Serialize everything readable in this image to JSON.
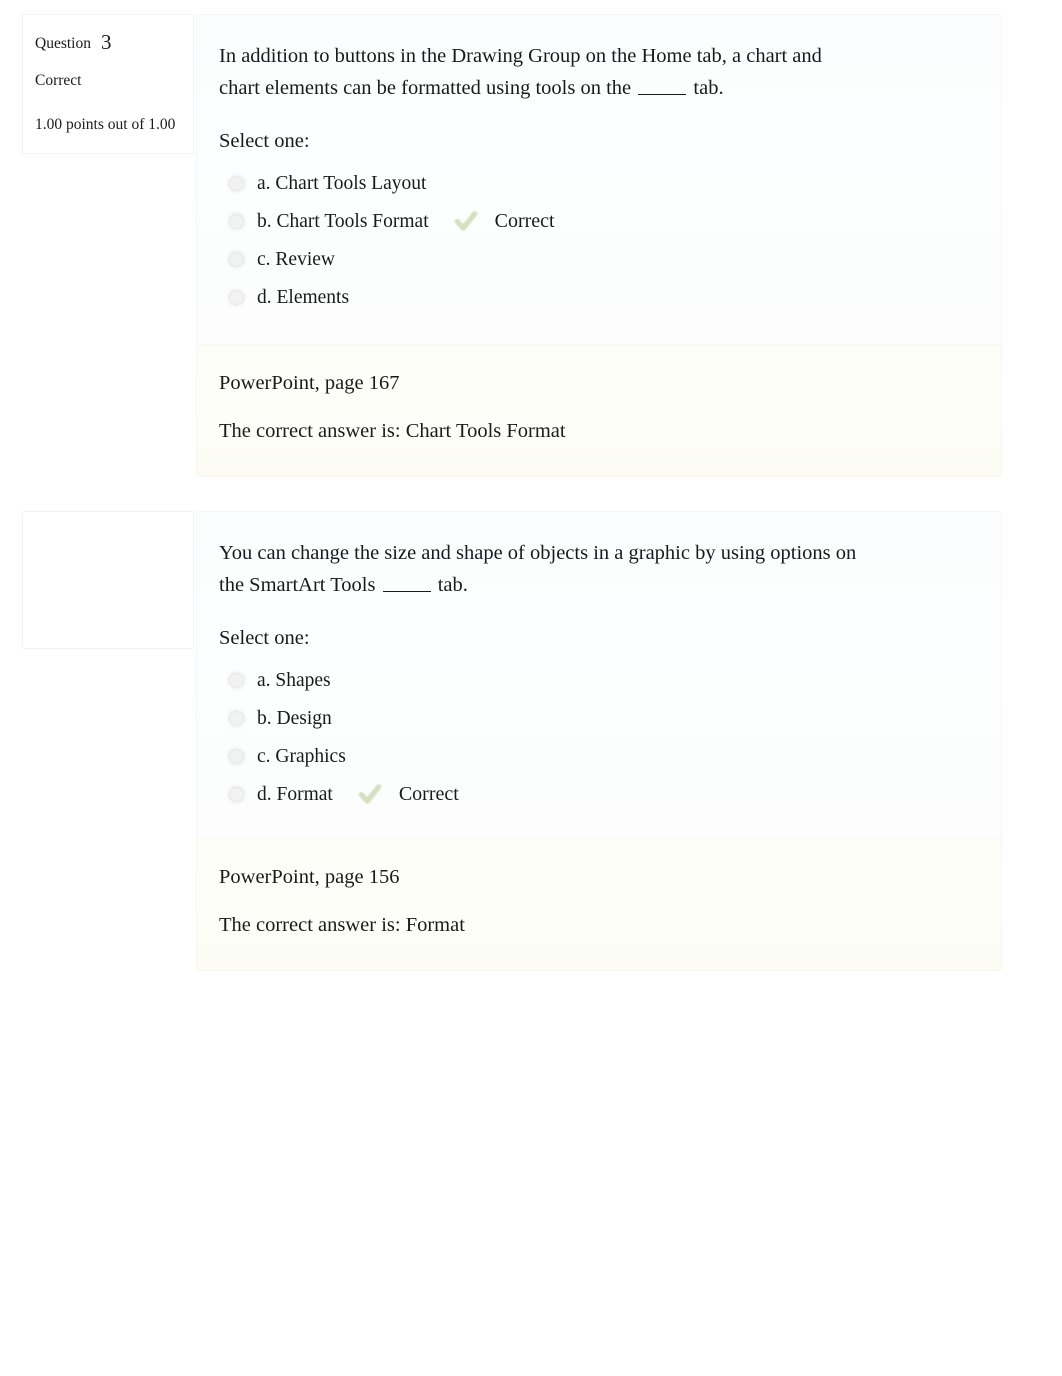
{
  "page": {
    "background_color": "#ffffff",
    "question_card_tint": "#fbfdfe",
    "feedback_card_tint": "#fdfdf7",
    "correct_icon_color": "#8a9a3c"
  },
  "questions": [
    {
      "info": {
        "question_label": "Question",
        "question_number": "3",
        "state": "Correct",
        "grade": "1.00 points out of 1.00"
      },
      "stem_before_blank": "In addition to buttons in the Drawing Group on the Home tab, a chart and chart elements can be formatted using tools on the ",
      "stem_after_blank": " tab.",
      "select_prompt": "Select one:",
      "options": [
        {
          "label": "a. Chart Tools Layout",
          "correct": false,
          "marker": ""
        },
        {
          "label": "b. Chart Tools Format",
          "correct": true,
          "marker": "Correct"
        },
        {
          "label": "c. Review",
          "correct": false,
          "marker": ""
        },
        {
          "label": "d. Elements",
          "correct": false,
          "marker": ""
        }
      ],
      "feedback": {
        "reference": "PowerPoint, page 167",
        "correct_answer": "The correct answer is: Chart Tools Format"
      }
    },
    {
      "info": {
        "question_label": "",
        "question_number": "",
        "state": "",
        "grade": ""
      },
      "stem_before_blank": "You can change the size and shape of objects in a graphic by using options on the SmartArt Tools ",
      "stem_after_blank": " tab.",
      "select_prompt": "Select one:",
      "options": [
        {
          "label": "a. Shapes",
          "correct": false,
          "marker": ""
        },
        {
          "label": "b. Design",
          "correct": false,
          "marker": ""
        },
        {
          "label": "c. Graphics",
          "correct": false,
          "marker": ""
        },
        {
          "label": "d. Format",
          "correct": true,
          "marker": "Correct"
        }
      ],
      "feedback": {
        "reference": "PowerPoint, page 156",
        "correct_answer": "The correct answer is: Format"
      }
    }
  ]
}
